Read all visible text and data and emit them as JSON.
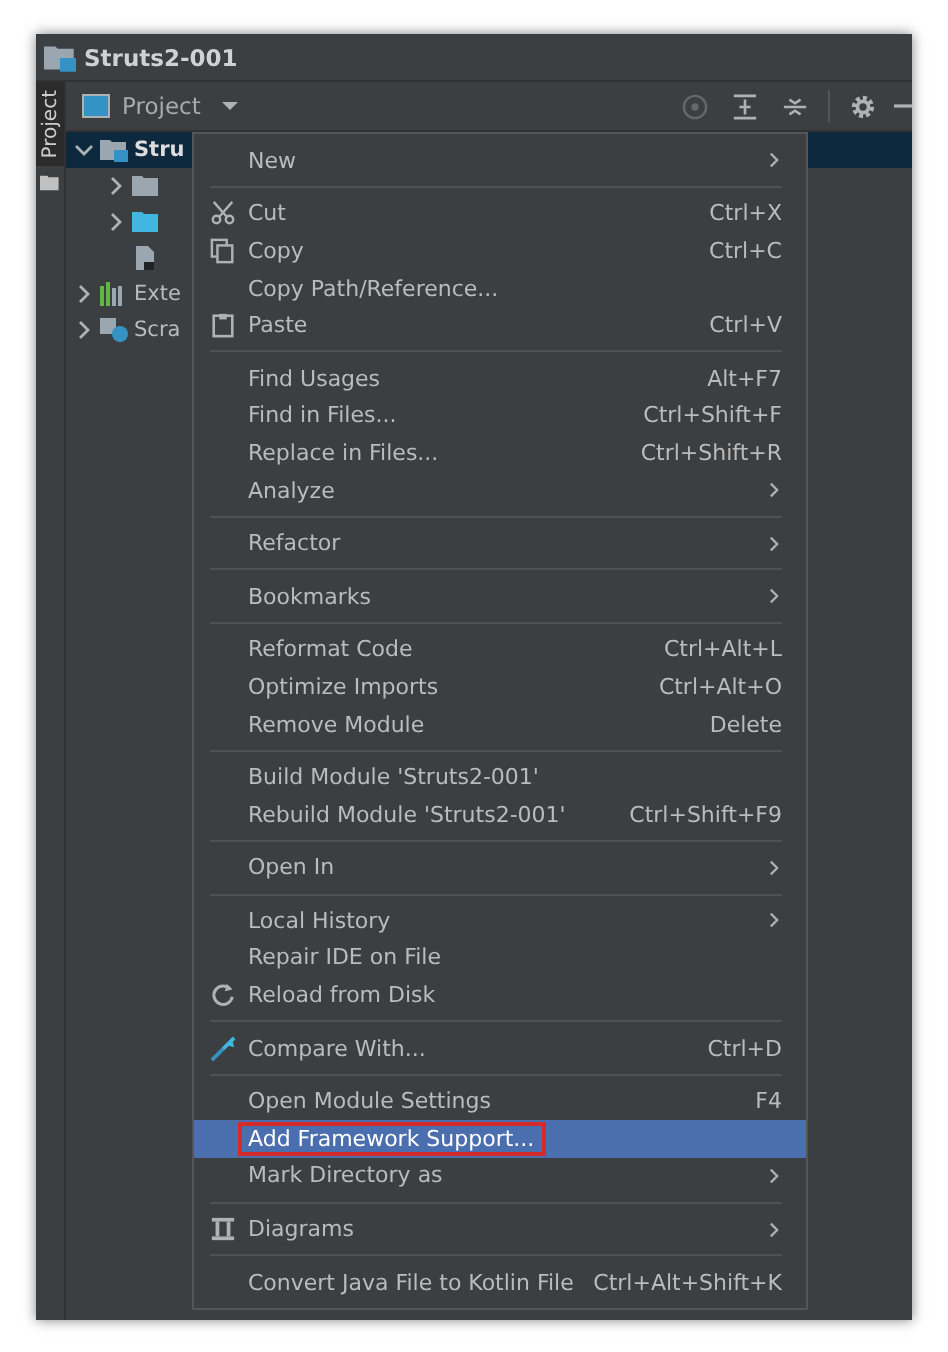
{
  "window": {
    "title": "Struts2-001"
  },
  "side_tab": {
    "label": "Project",
    "selected": true
  },
  "toolbar": {
    "view": "Project"
  },
  "tree": [
    {
      "label": "Stru",
      "selected": true,
      "expanded": true,
      "kind": "module"
    },
    {
      "selected": false,
      "expanded": false,
      "kind": "folder"
    },
    {
      "selected": false,
      "expanded": false,
      "kind": "source"
    },
    {
      "selected": false,
      "kind": "file"
    },
    {
      "label": "Exte",
      "selected": false,
      "expanded": false,
      "kind": "libraries"
    },
    {
      "label": "Scra",
      "selected": false,
      "expanded": false,
      "kind": "scratches"
    }
  ],
  "menu": [
    {
      "kind": "plain",
      "label": "New",
      "submenu": true,
      "selected": false,
      "outlined": false
    },
    {
      "kind": "separator"
    },
    {
      "kind": "cut",
      "label": "Cut",
      "shortcut": "Ctrl+X",
      "selected": false,
      "outlined": false
    },
    {
      "kind": "copy",
      "label": "Copy",
      "shortcut": "Ctrl+C",
      "selected": false,
      "outlined": false
    },
    {
      "kind": "plain",
      "label": "Copy Path/Reference...",
      "selected": false,
      "outlined": false
    },
    {
      "kind": "paste",
      "label": "Paste",
      "shortcut": "Ctrl+V",
      "selected": false,
      "outlined": false
    },
    {
      "kind": "separator"
    },
    {
      "kind": "plain",
      "label": "Find Usages",
      "shortcut": "Alt+F7",
      "selected": false,
      "outlined": false
    },
    {
      "kind": "plain",
      "label": "Find in Files...",
      "shortcut": "Ctrl+Shift+F",
      "selected": false,
      "outlined": false
    },
    {
      "kind": "plain",
      "label": "Replace in Files...",
      "shortcut": "Ctrl+Shift+R",
      "selected": false,
      "outlined": false
    },
    {
      "kind": "plain",
      "label": "Analyze",
      "submenu": true,
      "selected": false,
      "outlined": false
    },
    {
      "kind": "separator"
    },
    {
      "kind": "plain",
      "label": "Refactor",
      "submenu": true,
      "selected": false,
      "outlined": false
    },
    {
      "kind": "separator"
    },
    {
      "kind": "plain",
      "label": "Bookmarks",
      "submenu": true,
      "selected": false,
      "outlined": false
    },
    {
      "kind": "separator"
    },
    {
      "kind": "plain",
      "label": "Reformat Code",
      "shortcut": "Ctrl+Alt+L",
      "selected": false,
      "outlined": false
    },
    {
      "kind": "plain",
      "label": "Optimize Imports",
      "shortcut": "Ctrl+Alt+O",
      "selected": false,
      "outlined": false
    },
    {
      "kind": "plain",
      "label": "Remove Module",
      "shortcut": "Delete",
      "selected": false,
      "outlined": false
    },
    {
      "kind": "separator"
    },
    {
      "kind": "plain",
      "label": "Build Module 'Struts2-001'",
      "selected": false,
      "outlined": false
    },
    {
      "kind": "plain",
      "label": "Rebuild Module 'Struts2-001'",
      "shortcut": "Ctrl+Shift+F9",
      "selected": false,
      "outlined": false
    },
    {
      "kind": "separator"
    },
    {
      "kind": "plain",
      "label": "Open In",
      "submenu": true,
      "selected": false,
      "outlined": false
    },
    {
      "kind": "separator"
    },
    {
      "kind": "plain",
      "label": "Local History",
      "submenu": true,
      "selected": false,
      "outlined": false
    },
    {
      "kind": "plain",
      "label": "Repair IDE on File",
      "selected": false,
      "outlined": false
    },
    {
      "kind": "reload",
      "label": "Reload from Disk",
      "selected": false,
      "outlined": false
    },
    {
      "kind": "separator"
    },
    {
      "kind": "compare",
      "label": "Compare With...",
      "shortcut": "Ctrl+D",
      "selected": false,
      "outlined": false
    },
    {
      "kind": "separator"
    },
    {
      "kind": "plain",
      "label": "Open Module Settings",
      "shortcut": "F4",
      "selected": false,
      "outlined": false
    },
    {
      "kind": "plain",
      "label": "Add Framework Support...",
      "selected": true,
      "outlined": true
    },
    {
      "kind": "plain",
      "label": "Mark Directory as",
      "submenu": true,
      "selected": false,
      "outlined": false
    },
    {
      "kind": "separator"
    },
    {
      "kind": "diagrams",
      "label": "Diagrams",
      "submenu": true,
      "selected": false,
      "outlined": false
    },
    {
      "kind": "separator"
    },
    {
      "kind": "plain",
      "label": "Convert Java File to Kotlin File",
      "shortcut": "Ctrl+Alt+Shift+K",
      "selected": false,
      "outlined": false
    }
  ]
}
